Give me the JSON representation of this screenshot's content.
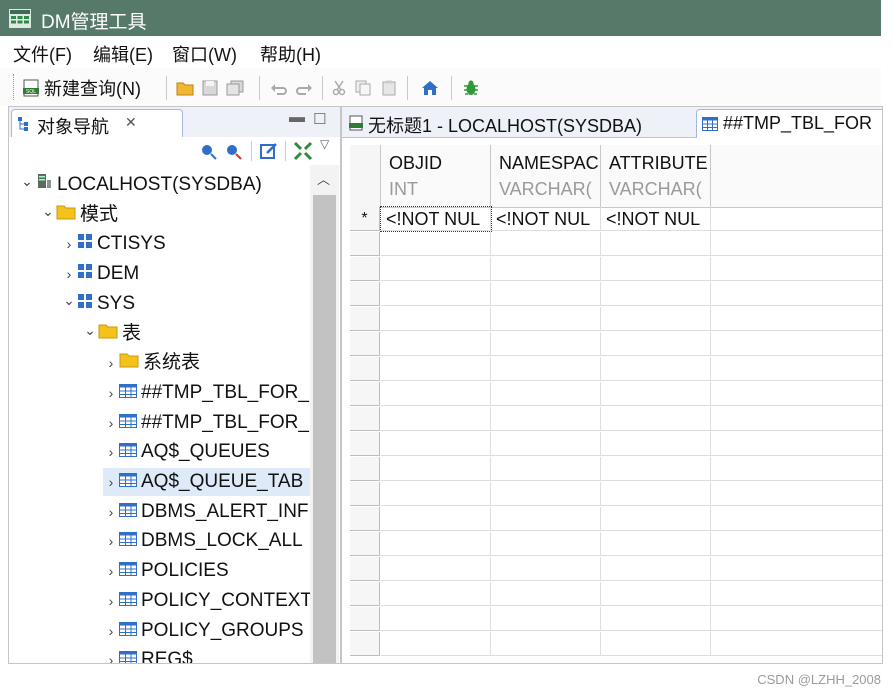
{
  "window": {
    "title": "DM管理工具"
  },
  "menu": [
    "文件(F)",
    "编辑(E)",
    "窗口(W)",
    "帮助(H)"
  ],
  "toolbar": {
    "new_query_label": "新建查询(N)"
  },
  "nav": {
    "tab_label": "对象导航",
    "tree": [
      {
        "label": "LOCALHOST(SYSDBA)",
        "icon": "server-icon",
        "expanded": true
      },
      {
        "label": "模式",
        "icon": "folder-icon",
        "expanded": true
      },
      {
        "label": "CTISYS",
        "icon": "schema-icon",
        "expanded": false
      },
      {
        "label": "DEM",
        "icon": "schema-icon",
        "expanded": false
      },
      {
        "label": "SYS",
        "icon": "schema-icon",
        "expanded": true
      },
      {
        "label": "表",
        "icon": "folder-icon",
        "expanded": true
      },
      {
        "label": "系统表",
        "icon": "folder-icon",
        "expanded": false
      },
      {
        "label": "##TMP_TBL_FOR_",
        "icon": "table-icon",
        "expanded": false
      },
      {
        "label": "##TMP_TBL_FOR_",
        "icon": "table-icon",
        "expanded": false
      },
      {
        "label": "AQ$_QUEUES",
        "icon": "table-icon",
        "expanded": false
      },
      {
        "label": "AQ$_QUEUE_TAB",
        "icon": "table-icon",
        "expanded": false
      },
      {
        "label": "DBMS_ALERT_INF",
        "icon": "table-icon",
        "expanded": false
      },
      {
        "label": "DBMS_LOCK_ALL",
        "icon": "table-icon",
        "expanded": false
      },
      {
        "label": "POLICIES",
        "icon": "table-icon",
        "expanded": false
      },
      {
        "label": "POLICY_CONTEXT",
        "icon": "table-icon",
        "expanded": false
      },
      {
        "label": "POLICY_GROUPS",
        "icon": "table-icon",
        "expanded": false
      },
      {
        "label": "REG$",
        "icon": "table-icon",
        "expanded": false
      }
    ]
  },
  "editor": {
    "tabs": [
      "无标题1 - LOCALHOST(SYSDBA)",
      "##TMP_TBL_FOR"
    ],
    "columns": [
      {
        "name": "OBJID",
        "type": "INT"
      },
      {
        "name": "NAMESPAC",
        "type": "VARCHAR("
      },
      {
        "name": "ATTRIBUTE",
        "type": "VARCHAR("
      }
    ],
    "new_row_marker": "*",
    "new_row_values": [
      "<!NOT NUL",
      "<!NOT NUL",
      "<!NOT NUL"
    ]
  },
  "watermark": "CSDN @LZHH_2008",
  "colors": {
    "titlebar": "#56796a",
    "accent": "#2f5fb3"
  }
}
